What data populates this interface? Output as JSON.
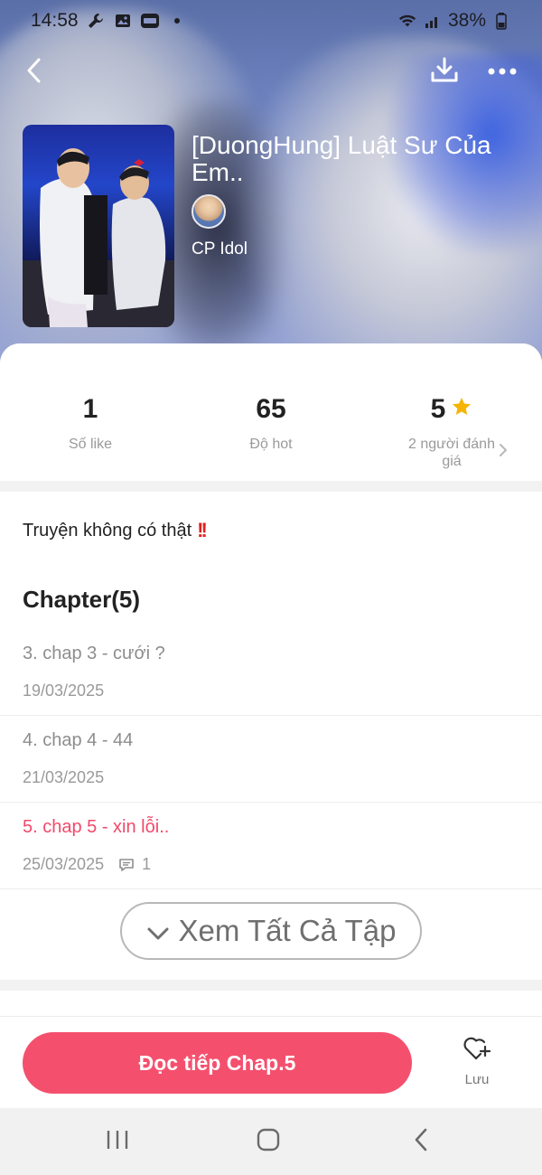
{
  "status_bar": {
    "time": "14:58",
    "battery": "38%"
  },
  "header": {
    "back_icon": "chevron-left-icon",
    "download_icon": "download-icon",
    "more_icon": "more-horizontal-icon"
  },
  "story": {
    "title": "[DuongHung] Luật Sư Của Em..",
    "author": "CP Idol"
  },
  "stats": {
    "likes": {
      "value": "1",
      "label": "Số like"
    },
    "hot": {
      "value": "65",
      "label": "Độ hot"
    },
    "rating": {
      "value": "5",
      "label": "2 người đánh giá",
      "star_color": "#f5b400"
    }
  },
  "description": "Truyện không có thật",
  "chapters": {
    "heading": "Chapter(5)",
    "items": [
      {
        "title": "3. chap 3 - cưới ?",
        "date": "19/03/2025",
        "active": false,
        "comments": ""
      },
      {
        "title": "4. chap 4 - 44",
        "date": "21/03/2025",
        "active": false,
        "comments": ""
      },
      {
        "title": "5. chap 5 - xin lỗi..",
        "date": "25/03/2025",
        "active": true,
        "comments": "1"
      }
    ],
    "see_all_label": "Xem Tất Cả Tập"
  },
  "actions": {
    "read_label": "Đọc tiếp Chap.5",
    "save_label": "Lưu",
    "accent": "#f4506e"
  },
  "system_nav": [
    "recent-apps-icon",
    "home-icon",
    "back-icon"
  ]
}
